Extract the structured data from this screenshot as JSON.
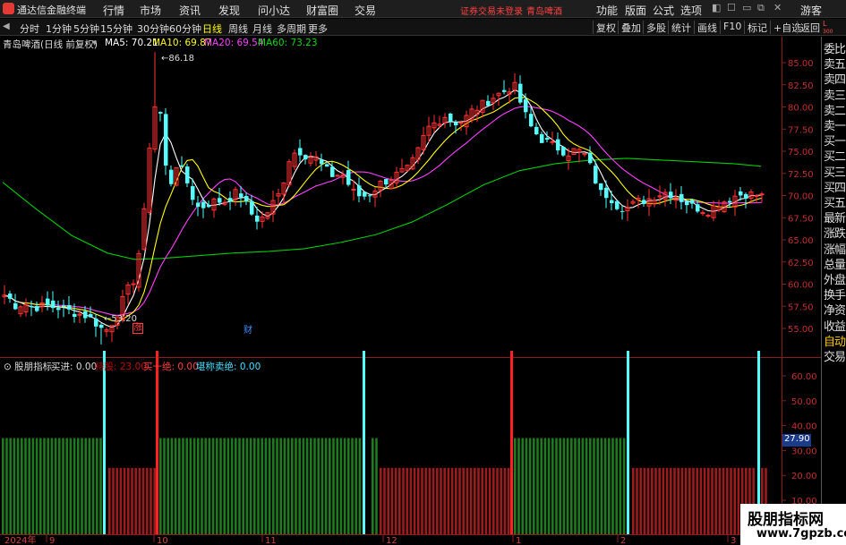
{
  "menubar": {
    "app_title": "通达信金融终端",
    "menus": [
      "行情",
      "市场",
      "资讯",
      "发现",
      "问小达",
      "财富圈",
      "交易"
    ],
    "notice": "证券交易未登录",
    "stock_tag": "青岛啤酒",
    "tools": [
      "功能",
      "版面",
      "公式",
      "选项"
    ],
    "guest": "游客"
  },
  "periodbar": {
    "periods": [
      "分时",
      "1分钟",
      "5分钟",
      "15分钟",
      "30分钟",
      "60分钟",
      "日线",
      "周线",
      "月线",
      "多周期",
      "更多"
    ],
    "active": "日线",
    "right_buttons": [
      "复权",
      "叠加",
      "多股",
      "统计",
      "画线",
      "F10",
      "标记",
      "+自选",
      "返回"
    ]
  },
  "main_chart": {
    "stock_name": "青岛啤酒",
    "mode": "(日线 前复权)",
    "ma": [
      {
        "label": "MA5: 70.21",
        "color": "#ffffff"
      },
      {
        "label": "MA10: 69.87",
        "color": "#ffff00"
      },
      {
        "label": "MA20: 69.54",
        "color": "#ff40ff"
      },
      {
        "label": "MA60: 73.23",
        "color": "#00ff00"
      }
    ],
    "high_label": "86.18",
    "low_label": "53.20",
    "marker_zhang": "涨",
    "marker_cai": "财",
    "price_ticks": [
      "85.00",
      "82.50",
      "80.00",
      "77.50",
      "75.00",
      "72.50",
      "70.00",
      "67.50",
      "65.00",
      "62.50",
      "60.00",
      "57.50",
      "55.00"
    ]
  },
  "indicator": {
    "name": "股朋指标",
    "items": [
      {
        "label": "买进: 0.00",
        "color": "#dddddd"
      },
      {
        "label": "持股: 23.00",
        "color": "#c00000"
      },
      {
        "label": "买一绝: 0.00",
        "color": "#ff4040"
      },
      {
        "label": "堪称卖绝: 0.00",
        "color": "#40e0ff"
      }
    ],
    "ticks": [
      "60.00",
      "50.00",
      "40.00",
      "30.00",
      "20.00",
      "10.00"
    ],
    "current_value": "27.90"
  },
  "time_axis": {
    "labels": [
      "2024年",
      "9",
      "10",
      "11",
      "12",
      "1",
      "2",
      "3"
    ]
  },
  "side_panel": {
    "items": [
      "委比",
      "卖五",
      "卖四",
      "卖三",
      "卖二",
      "卖一",
      "买一",
      "买二",
      "买三",
      "买四",
      "买五",
      "最新",
      "涨跌",
      "涨幅",
      "总量",
      "外盘",
      "换手",
      "净资",
      "收益",
      "自动",
      "交易"
    ],
    "badge": "L 300"
  },
  "watermark": {
    "line1": "股朋指标网",
    "line2": "www.7gpzb.com"
  },
  "colors": {
    "up": "#ff3333",
    "down": "#54ffff",
    "ma5": "#ffffff",
    "ma10": "#ffff00",
    "ma20": "#ff40ff",
    "ma60": "#00cc00",
    "green_bar": "#1f7a1f",
    "red_bar": "#9b1c1c"
  }
}
